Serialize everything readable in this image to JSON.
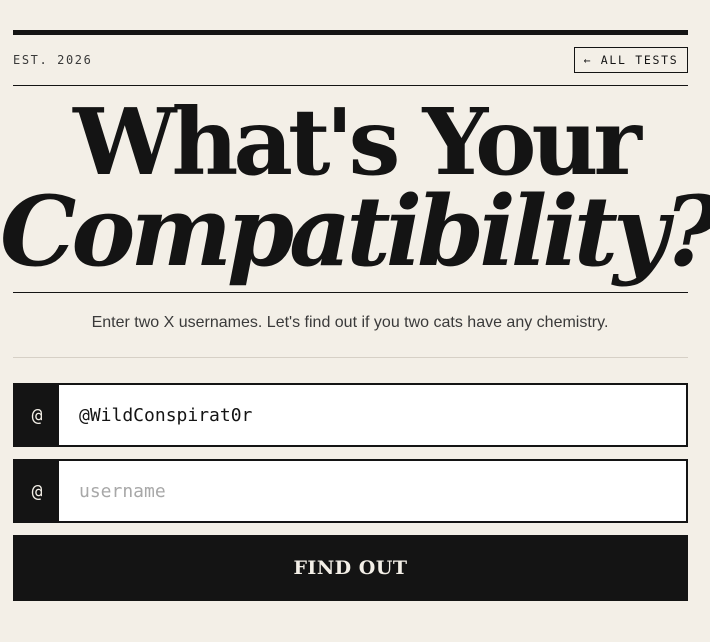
{
  "header": {
    "est_label": "EST. 2026",
    "all_tests_label": "← ALL TESTS"
  },
  "title": {
    "line1": "What's Your",
    "line2": "Compatibility?"
  },
  "subtitle": "Enter two X usernames. Let's find out if you two cats have any chemistry.",
  "form": {
    "prefix_symbol": "@",
    "username1": {
      "value": "@WildConspirat0r",
      "placeholder": "username"
    },
    "username2": {
      "value": "",
      "placeholder": "username"
    },
    "submit_label": "FIND OUT"
  },
  "colors": {
    "background": "#f3efe7",
    "ink": "#141414",
    "placeholder": "#a8a8a8"
  }
}
